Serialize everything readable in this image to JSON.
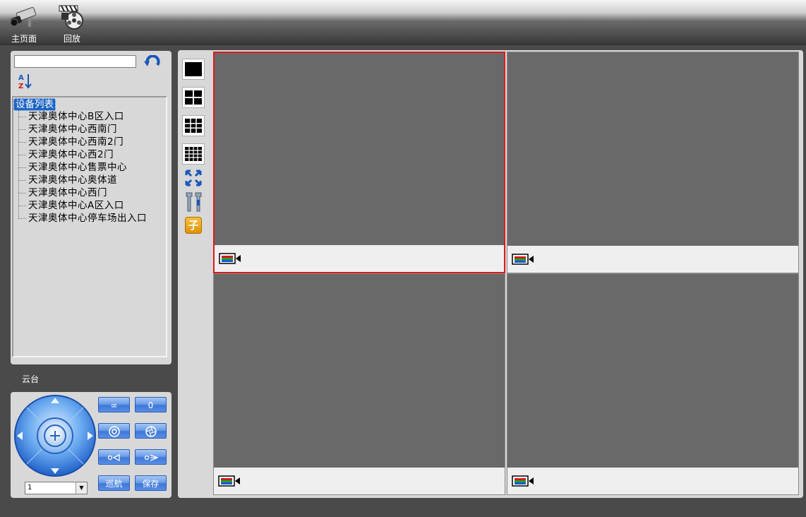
{
  "toolbar": {
    "home_label": "主页面",
    "playback_label": "回放"
  },
  "device_panel": {
    "search_value": "",
    "root_label": "设备列表",
    "devices": [
      "天津奥体中心B区入口",
      "天津奥体中心西南门",
      "天津奥体中心西南2门",
      "天津奥体中心西2门",
      "天津奥体中心售票中心",
      "天津奥体中心奥体道",
      "天津奥体中心西门",
      "天津奥体中心A区入口",
      "天津奥体中心停车场出入口"
    ]
  },
  "ptz": {
    "label": "云台",
    "preset_selected": "1",
    "cruise_label": "巡航",
    "save_label": "保存",
    "button_labels": [
      "∞",
      "0"
    ]
  },
  "layout_toolbar": {
    "sub_stream_label": "子"
  },
  "video_grid": {
    "selected_cell": 0,
    "cells": 4
  },
  "colors": {
    "selected_border": "#e01818",
    "tree_highlight": "#1c64c4",
    "video_bg": "#696969"
  }
}
